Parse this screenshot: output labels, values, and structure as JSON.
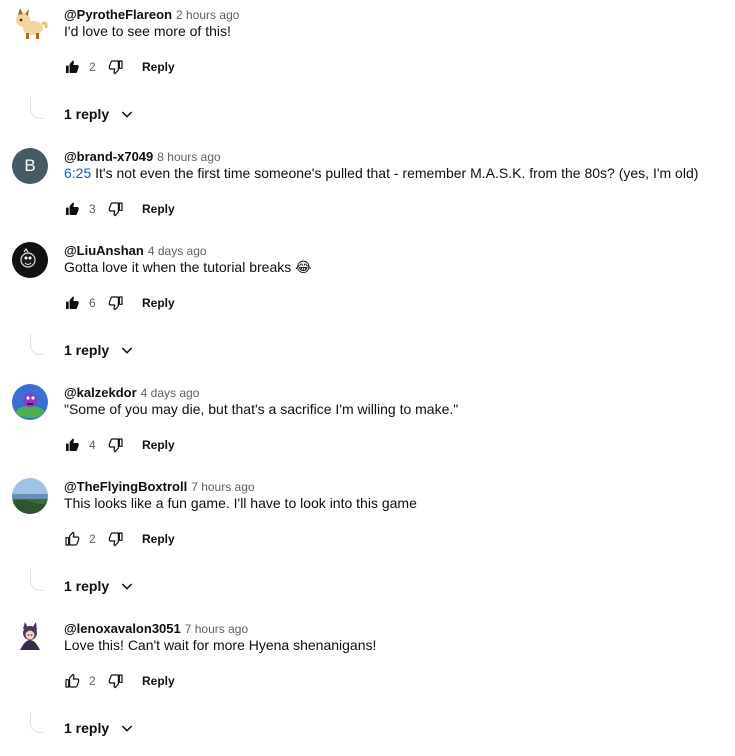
{
  "comments": [
    {
      "author": "@PyrotheFlareon",
      "time": "2 hours ago",
      "timestamp": "",
      "text": "I'd love to see more of this!",
      "likes": "2",
      "reply_label": "Reply",
      "replies": "1 reply",
      "avatar": "flareon-avatar"
    },
    {
      "author": "@brand-x7049",
      "time": "8 hours ago",
      "timestamp": "6:25",
      "text": "It's not even the first time someone's pulled that - remember M.A.S.K. from the 80s? (yes, I'm old)",
      "likes": "3",
      "reply_label": "Reply",
      "avatar_letter": "B",
      "avatar": "letter-avatar"
    },
    {
      "author": "@LiuAnshan",
      "time": "4 days ago",
      "timestamp": "",
      "text": "Gotta love it when the tutorial breaks 😂",
      "likes": "6",
      "reply_label": "Reply",
      "replies": "1 reply",
      "avatar": "dark-avatar"
    },
    {
      "author": "@kalzekdor",
      "time": "4 days ago",
      "timestamp": "",
      "text": "\"Some of you may die, but that's a sacrifice I'm willing to make.\"",
      "likes": "4",
      "reply_label": "Reply",
      "avatar": "cartoon-avatar"
    },
    {
      "author": "@TheFlyingBoxtroll",
      "time": "7 hours ago",
      "timestamp": "",
      "text": "This looks like a fun game. I'll have to look into this game",
      "likes": "2",
      "reply_label": "Reply",
      "replies": "1 reply",
      "avatar": "landscape-avatar"
    },
    {
      "author": "@lenoxavalon3051",
      "time": "7 hours ago",
      "timestamp": "",
      "text": "Love this! Can't wait for more Hyena shenanigans!",
      "likes": "2",
      "reply_label": "Reply",
      "replies": "1 reply",
      "avatar": "character-avatar"
    }
  ],
  "colors": {
    "timestamp_link": "#065fd4",
    "meta_text": "#606060",
    "letter_avatar_bg": "#455a64"
  }
}
